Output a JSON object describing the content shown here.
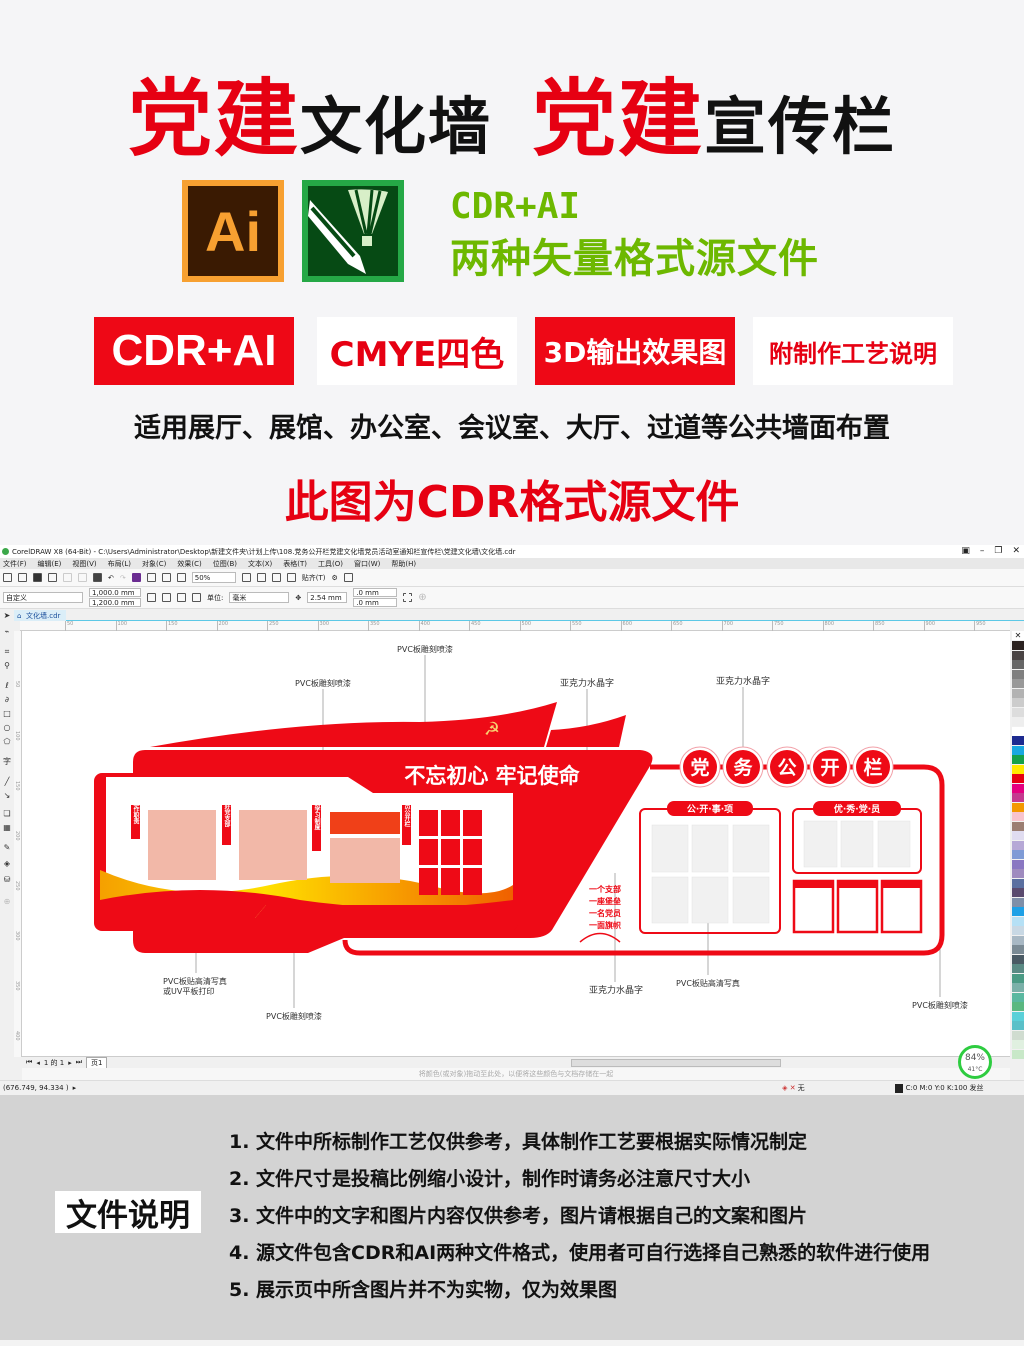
{
  "headline": {
    "part1_red": "党建",
    "part1_black": "文化墙",
    "part2_red": "党建",
    "part2_black": "宣传栏"
  },
  "logos": {
    "ai_text": "Ai",
    "ai_colors": {
      "frame": "#f7a031",
      "bg": "#3a1a02"
    },
    "cdr_colors": {
      "frame": "#25a846",
      "bg": "#064a14"
    }
  },
  "formats": {
    "line1": "CDR+AI",
    "line2": "两种矢量格式源文件",
    "color": "#6db800"
  },
  "badges": [
    {
      "label": "CDR+AI",
      "style": "red"
    },
    {
      "label": "CMYE四色",
      "style": "white"
    },
    {
      "label": "3D输出效果图",
      "style": "red"
    },
    {
      "label": "附制作工艺说明",
      "style": "white"
    }
  ],
  "usage": "适用展厅、展馆、办公室、会议室、大厅、过道等公共墙面布置",
  "source_note": "此图为CDR格式源文件",
  "brand_red": "#e60012",
  "coreldraw": {
    "title": "CorelDRAW X8 (64-Bit) - C:\\Users\\Administrator\\Desktop\\新建文件夹\\计划上传\\108.党务公开栏党建文化墙党员活动室通知栏宣传栏\\党建文化墙\\文化墙.cdr",
    "menu": [
      "文件(F)",
      "编辑(E)",
      "视图(V)",
      "布局(L)",
      "对象(C)",
      "效果(C)",
      "位图(B)",
      "文本(X)",
      "表格(T)",
      "工具(O)",
      "窗口(W)",
      "帮助(H)"
    ],
    "toolbar": {
      "zoom": "50%",
      "snap": "贴齐(T)"
    },
    "property_bar": {
      "page_preset": "自定义",
      "width": "1,000.0 mm",
      "height": "1,200.0 mm",
      "units_label": "单位:",
      "units": "毫米",
      "nudge": "2.54 mm",
      "dup_x": ".0 mm",
      "dup_y": ".0 mm"
    },
    "doc_tab": "文化墙.cdr",
    "ruler_h": [
      50,
      100,
      150,
      200,
      250,
      300,
      350,
      400,
      450,
      500,
      550,
      600,
      650,
      700,
      750,
      800,
      850,
      900,
      950
    ],
    "ruler_v": [
      50,
      100,
      150,
      200,
      250,
      300,
      350,
      400
    ],
    "page_nav": {
      "position": "1 的 1",
      "page_tab": "页1"
    },
    "hint": "将颜色(或对象)拖动至此处，以便将这些颜色与文档存储在一起",
    "status": {
      "coords": "(676.749, 94.334 )",
      "fill": "无",
      "outline": "C:0 M:0 Y:0 K:100 发丝"
    },
    "perf": {
      "cpu": "84%",
      "temp": "41°C"
    },
    "palette": [
      "#2b2220",
      "#4a4444",
      "#666",
      "#808080",
      "#999",
      "#b3b3b3",
      "#ccc",
      "#ddd",
      "#eee",
      "#fff",
      "#1d2a8f",
      "#19a8e0",
      "#15a04a",
      "#ffe800",
      "#e60012",
      "#e4007f",
      "#c4398f",
      "#f39800",
      "#f8c3cd",
      "#9b7e72",
      "#e0dcf0",
      "#b6a8d6",
      "#7f9bd6",
      "#8a77c2",
      "#9f8bbf",
      "#5a6fa0",
      "#5a4a6e",
      "#7f8fa8",
      "#1ea0e6",
      "#b5e0f5",
      "#c8d8e4",
      "#a8b8c4",
      "#7a8a94",
      "#4a5a64",
      "#5a8a84",
      "#4a9a84",
      "#7ab0a8",
      "#5ab8a0",
      "#5ab880",
      "#5ad0d8",
      "#5ac0c8",
      "#d0dcd0",
      "#e0f0e0",
      "#c8e8c8"
    ]
  },
  "design": {
    "slogan": "不忘初心 牢记使命",
    "column_tabs": [
      "工作职责",
      "五好党支部",
      "党员学习制度",
      "党员公开栏"
    ],
    "board_chars": [
      "党",
      "务",
      "公",
      "开",
      "栏"
    ],
    "box1_title": "公·开·事·项",
    "box2_title": "优·秀·党·员",
    "mottos": [
      "一个支部",
      "一座堡垒",
      "一名党员",
      "一面旗帜"
    ],
    "labels": {
      "flag_top": "PVC板雕刻喷漆",
      "body_top": "PVC板雕刻喷漆",
      "slogan_text": "亚克力水晶字",
      "board_chars": "亚克力水晶字",
      "panel_print_1": "PVC板贴高清写真",
      "panel_print_2": "或UV平板打印",
      "body_bottom": "PVC板雕刻喷漆",
      "mottos": "亚克力水晶字",
      "box_print": "PVC板贴高清写真",
      "frame": "PVC板雕刻喷漆"
    }
  },
  "notes": {
    "title": "文件说明",
    "items": [
      "1. 文件中所标制作工艺仅供参考，具体制作工艺要根据实际情况制定",
      "2. 文件尺寸是投稿比例缩小设计，制作时请务必注意尺寸大小",
      "3. 文件中的文字和图片内容仅供参考，图片请根据自己的文案和图片",
      "4. 源文件包含CDR和AI两种文件格式，使用者可自行选择自己熟悉的软件进行使用",
      "5. 展示页中所含图片并不为实物，仅为效果图"
    ]
  }
}
